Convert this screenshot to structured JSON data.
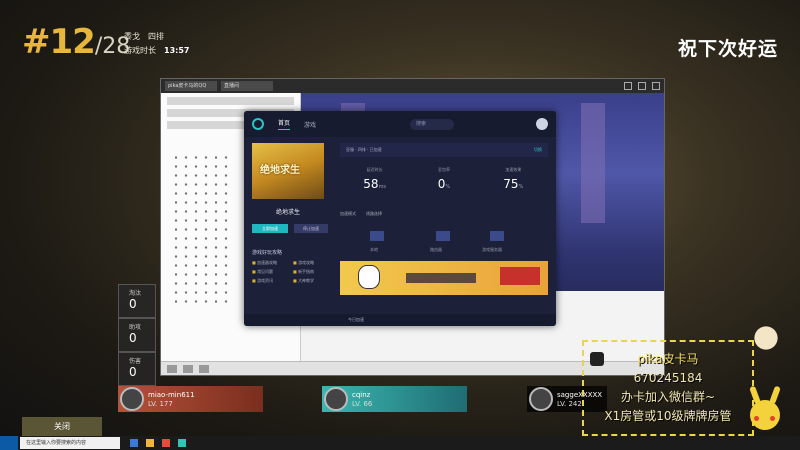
{
  "hud": {
    "rank": "#12",
    "total": "/28",
    "player_name": "黍戈",
    "team_mode": "四排",
    "time_label": "游戏时长",
    "time_value": "13:57",
    "banner": "祝下次好运"
  },
  "share_window": {
    "tabs": [
      "pika皮卡马的QQ",
      "直播间"
    ]
  },
  "accelerator": {
    "nav": [
      "首页",
      "游戏"
    ],
    "search_placeholder": "搜索",
    "game_cover_title": "绝地求生",
    "game_name": "绝地求生",
    "accelerate_button": "立即加速",
    "other_button": "停止加速",
    "guide_title": "游戏好玩攻略",
    "guide_items": [
      "加速器攻略",
      "游戏攻略",
      "常见问题",
      "新手指南",
      "游戏资讯",
      "大神教学"
    ],
    "server_text": "亚服 · 四排 · 已加速",
    "switch_label": "切换",
    "stats": [
      {
        "label": "延迟时长",
        "value": "58",
        "unit": "ms"
      },
      {
        "label": "丢包率",
        "value": "0",
        "unit": "%"
      },
      {
        "label": "加速效果",
        "value": "75",
        "unit": "%"
      }
    ],
    "net_tabs": [
      "加速模式",
      "线路选择"
    ],
    "net_labels": [
      "本地",
      "路由器",
      "游戏服务器"
    ],
    "bottom_text": "今日加速"
  },
  "scoreboard": [
    {
      "label": "淘汰",
      "value": "0"
    },
    {
      "label": "助攻",
      "value": "0"
    },
    {
      "label": "伤害",
      "value": "0"
    }
  ],
  "players": [
    {
      "name": "miao-min611",
      "level": "LV. 177"
    },
    {
      "name": "cqinz",
      "level": "LV. 66"
    },
    {
      "name": "saggeXXXXX",
      "level": "LV. 242"
    }
  ],
  "promo": {
    "line1": "pika皮卡马",
    "line2": "670245184",
    "line3": "办卡加入微信群~",
    "line4": "X1房管或10级牌牌房管"
  },
  "close_label": "关闭",
  "taskbar": {
    "search_placeholder": "在这里输入你要搜索的内容"
  }
}
